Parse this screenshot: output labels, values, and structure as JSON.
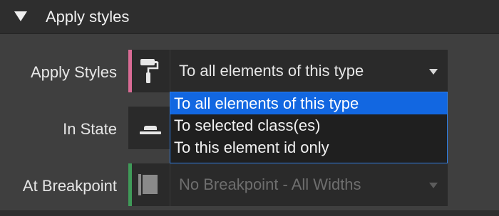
{
  "section": {
    "title": "Apply styles",
    "collapse_icon": "triangle-down-icon"
  },
  "rows": {
    "apply_styles": {
      "label": "Apply Styles",
      "icon": "paint-roller-icon",
      "accent_color": "#d96b95",
      "value": "To all elements of this type"
    },
    "in_state": {
      "label": "In State",
      "icon": "state-button-icon"
    },
    "at_breakpoint": {
      "label": "At Breakpoint",
      "icon": "breakpoint-square-icon",
      "accent_color": "#3f9a58",
      "value": "No Breakpoint - All Widths"
    }
  },
  "dropdown": {
    "options": [
      "To all elements of this type",
      "To selected class(es)",
      "To this element id only"
    ],
    "selected_index": 0,
    "highlight_color": "#1267e1",
    "border_color": "#2f7fe6"
  }
}
